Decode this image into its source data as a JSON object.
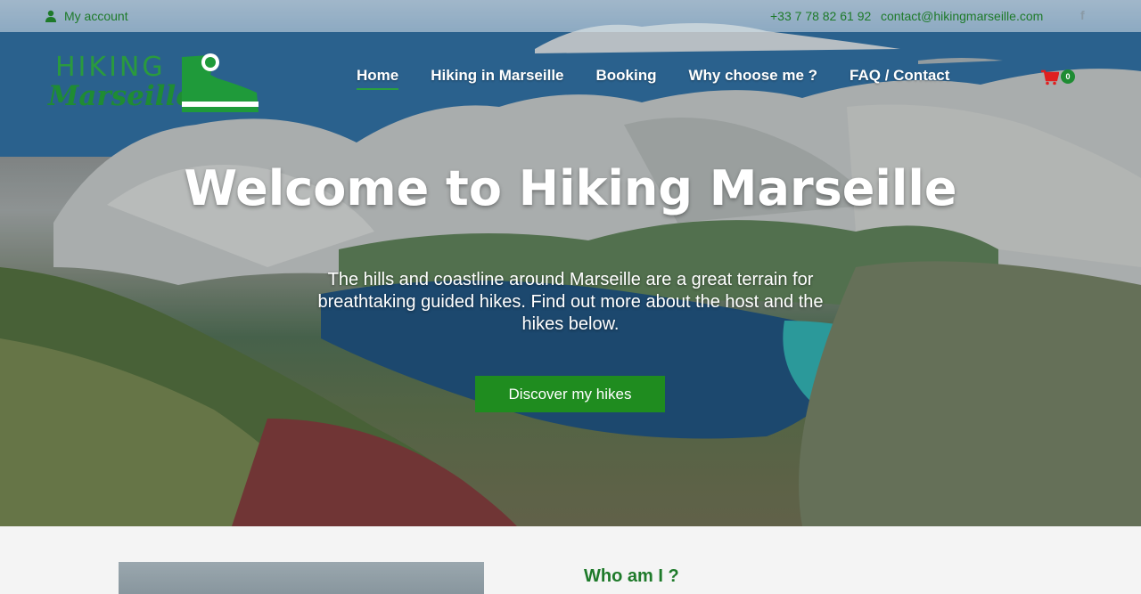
{
  "topbar": {
    "account_label": "My account",
    "phone": "+33 7 78 82 61 92",
    "email": "contact@hikingmarseille.com",
    "social_icon": "f"
  },
  "logo": {
    "line1": "HIKING",
    "line2": "Marseille"
  },
  "nav": {
    "items": [
      {
        "label": "Home",
        "active": true
      },
      {
        "label": "Hiking in Marseille",
        "active": false
      },
      {
        "label": "Booking",
        "active": false
      },
      {
        "label": "Why choose me ?",
        "active": false
      },
      {
        "label": "FAQ / Contact",
        "active": false
      }
    ],
    "cart_count": "0"
  },
  "hero": {
    "title": "Welcome to Hiking Marseille",
    "subtitle": "The hills and coastline around Marseille are a great terrain for breathtaking guided hikes. Find out more about the host and the hikes below.",
    "cta_label": "Discover my hikes"
  },
  "section": {
    "heading": "Who am I ?"
  },
  "colors": {
    "brand_green": "#1f8c33",
    "cta_green": "#1f8c1f",
    "cart_red": "#e02020"
  }
}
